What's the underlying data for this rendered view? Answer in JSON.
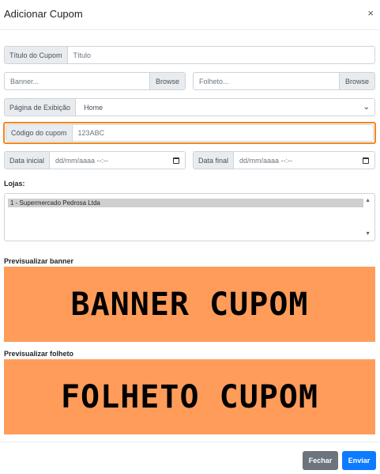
{
  "modal": {
    "title": "Adicionar Cupom",
    "close": "×"
  },
  "form": {
    "titulo": {
      "label": "Título do Cupom",
      "placeholder": "Título"
    },
    "banner": {
      "placeholder": "Banner...",
      "browse": "Browse"
    },
    "folheto": {
      "placeholder": "Folheto...",
      "browse": "Browse"
    },
    "pagina": {
      "label": "Página de Exibição",
      "selected": "Home"
    },
    "codigo": {
      "label": "Código do cupom",
      "placeholder": "123ABC"
    },
    "data_inicial": {
      "label": "Data inicial",
      "placeholder": "dd/mm/aaaa --:--"
    },
    "data_final": {
      "label": "Data final",
      "placeholder": "dd/mm/aaaa --:--"
    },
    "lojas": {
      "label": "Lojas:",
      "options": [
        "1 - Supermercado Pedrosa Ltda"
      ]
    }
  },
  "preview": {
    "banner_label": "Previsualizar banner",
    "banner_text": "BANNER CUPOM",
    "folheto_label": "Previsualizar folheto",
    "folheto_text": "FOLHETO CUPOM",
    "bg_color": "#ff9c5a"
  },
  "footer": {
    "fechar": "Fechar",
    "enviar": "Enviar"
  },
  "colors": {
    "highlight": "#f0891c",
    "primary": "#0d7bff",
    "secondary": "#6c757d"
  }
}
